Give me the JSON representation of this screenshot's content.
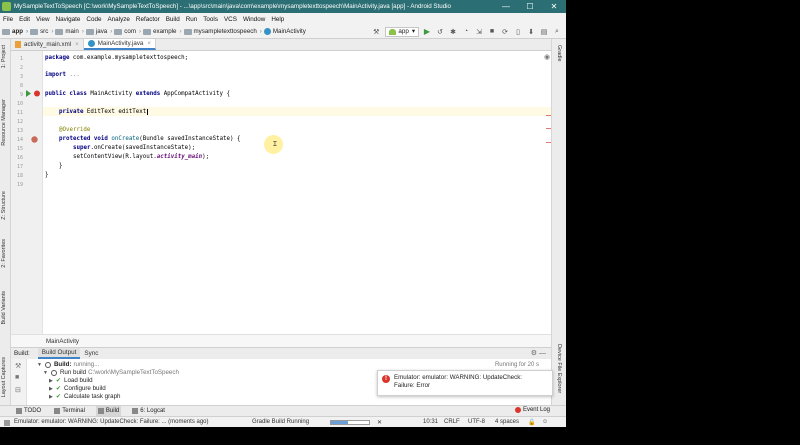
{
  "window": {
    "title": "MySampleTextToSpeech [C:\\work\\MySampleTextToSpeech] - ...\\app\\src\\main\\java\\com\\example\\mysampletexttospeech\\MainActivity.java [app] - Android Studio",
    "minimize": "—",
    "maximize": "☐",
    "close": "✕"
  },
  "menu": [
    "File",
    "Edit",
    "View",
    "Navigate",
    "Code",
    "Analyze",
    "Refactor",
    "Build",
    "Run",
    "Tools",
    "VCS",
    "Window",
    "Help"
  ],
  "nav": {
    "crumbs": [
      "app",
      "src",
      "main",
      "java",
      "com",
      "example",
      "mysampletexttospeech",
      "MainActivity"
    ],
    "run_config": "app",
    "run_config_caret": "▾"
  },
  "editor_tabs": [
    {
      "label": "activity_main.xml",
      "close": "×"
    },
    {
      "label": "MainActivity.java",
      "close": "×"
    }
  ],
  "code": {
    "line_numbers": [
      "1",
      "2",
      "3",
      "8",
      "9",
      "10",
      "11",
      "12",
      "13",
      "14",
      "15",
      "16",
      "17",
      "18",
      "19"
    ],
    "package_kw": "package",
    "package_name": " com.example.mysampletexttospeech;",
    "import_kw": "import",
    "import_fold": " ...",
    "class_kw1": "public class",
    "class_name": " MainActivity ",
    "class_kw2": "extends",
    "class_rest": " AppCompatActivity {",
    "field_kw": "private",
    "field_rest": " EditText editText",
    "override": "@Override",
    "method_kw": "protected void",
    "method_name": " onCreate",
    "method_rest": "(Bundle savedInstanceState) {",
    "super_kw": "super",
    "super_rest": ".onCreate(savedInstanceState);",
    "setcontent_a": "setContentView(R.layout.",
    "setcontent_b": "activity_main",
    "setcontent_c": ");",
    "close1": "}",
    "close2": "}"
  },
  "editor_breadcrumb": "MainActivity",
  "left_tools": [
    "1: Project",
    "Resource Manager",
    "Z: Structure",
    "2: Favorites",
    "Build Variants",
    "Layout Captures"
  ],
  "right_tools": [
    "Gradle",
    "Device File Explorer"
  ],
  "build": {
    "label": "Build:",
    "tabs": [
      "Build Output",
      "Sync"
    ],
    "running_text": "Running for 20 s",
    "tree": [
      {
        "text": "Build:",
        "muted": "running..."
      },
      {
        "text": "Run build",
        "muted": "C:\\work\\MySampleTextToSpeech"
      },
      {
        "text": "Load build",
        "muted": ""
      },
      {
        "text": "Configure build",
        "muted": ""
      },
      {
        "text": "Calculate task graph",
        "muted": ""
      }
    ]
  },
  "notification": {
    "line1": "Emulator: emulator: WARNING: UpdateCheck:",
    "line2": "Failure: Error",
    "icon": "!"
  },
  "bottom_tools": [
    "TODO",
    "Terminal",
    "Build",
    "6: Logcat"
  ],
  "event_log": "Event Log",
  "status": {
    "message": "Emulator: emulator: WARNING: UpdateCheck: Failure: ... (moments ago)",
    "task": "Gradle Build Running",
    "progress": 0.45,
    "position": "10:31",
    "line_sep": "CRLF",
    "encoding": "UTF-8",
    "indent": "4 spaces"
  }
}
